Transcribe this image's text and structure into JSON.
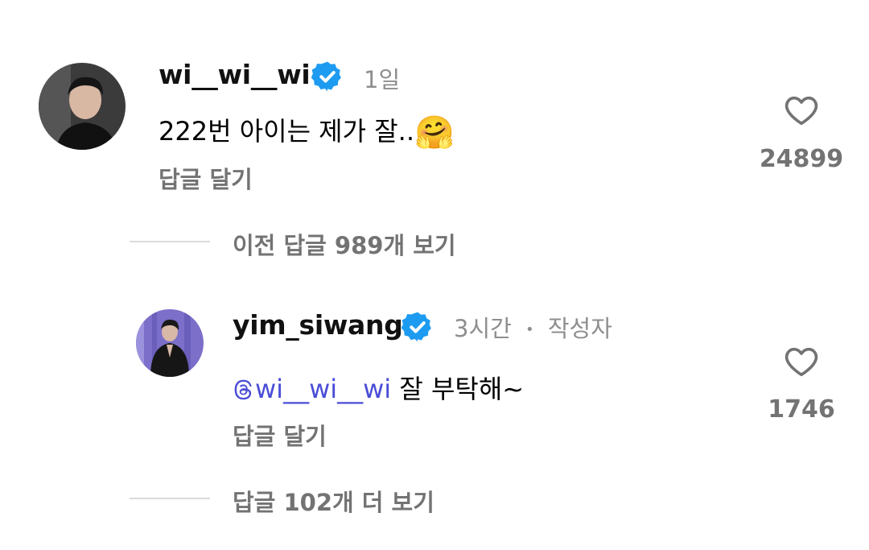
{
  "comment1": {
    "username": "wi__wi__wi",
    "time": "1일",
    "text": "222번 아이는 제가 잘..",
    "emoji": "🤗",
    "reply_label": "답글 달기",
    "likes": "24899",
    "verified": true
  },
  "view_previous": {
    "label": "이전 답글 989개 보기"
  },
  "reply": {
    "username": "yim_siwang",
    "time": "3시간",
    "separator": "•",
    "author_label": "작성자",
    "mention": "wi__wi__wi",
    "text": "잘 부탁해~",
    "reply_label": "답글 달기",
    "likes": "1746",
    "verified": true
  },
  "view_more": {
    "label": "답글 102개 더 보기"
  },
  "colors": {
    "verified_blue": "#1d9bf0",
    "mention_color": "#4a4dd6",
    "muted_gray": "#737373"
  }
}
